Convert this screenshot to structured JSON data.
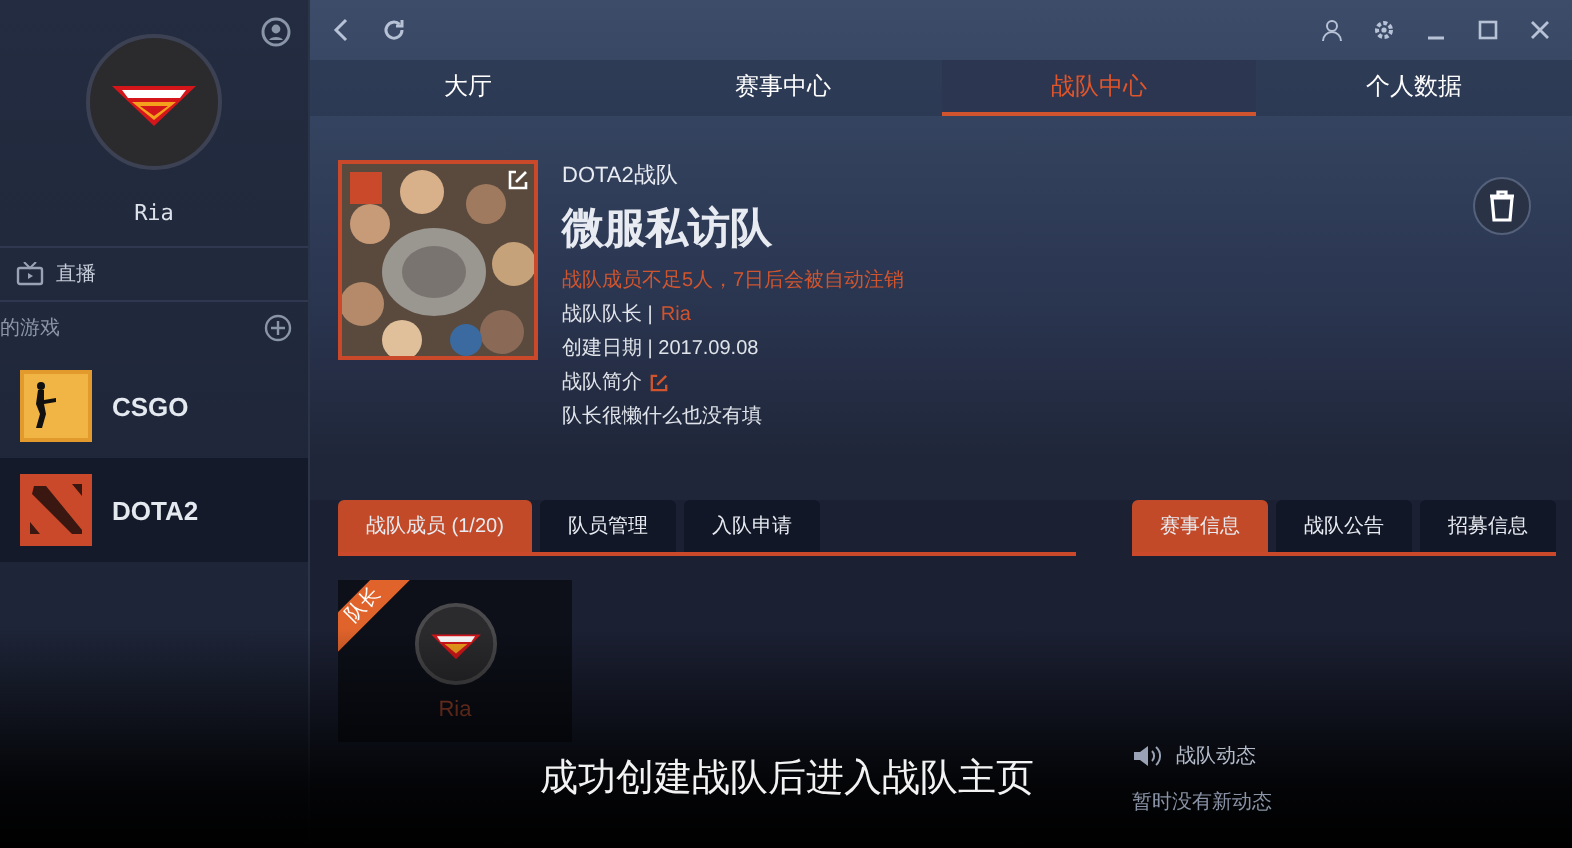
{
  "sidebar": {
    "username": "Ria",
    "live_label": "直播",
    "games_heading": "的游戏",
    "games": [
      {
        "name": "CSGO",
        "kind": "csgo",
        "selected": false
      },
      {
        "name": "DOTA2",
        "kind": "dota",
        "selected": true
      }
    ]
  },
  "nav_tabs": [
    {
      "label": "大厅",
      "selected": false
    },
    {
      "label": "赛事中心",
      "selected": false
    },
    {
      "label": "战队中心",
      "selected": true
    },
    {
      "label": "个人数据",
      "selected": false
    }
  ],
  "team": {
    "game_label": "DOTA2战队",
    "name": "微服私访队",
    "warning": "战队成员不足5人，7日后会被自动注销",
    "captain_label": "战队队长 |",
    "captain": "Ria",
    "created": "创建日期 | 2017.09.08",
    "intro_label": "战队简介",
    "intro": "队长很懒什么也没有填"
  },
  "member_tabs": [
    {
      "label": "战队成员 (1/20)",
      "selected": true
    },
    {
      "label": "队员管理",
      "selected": false
    },
    {
      "label": "入队申请",
      "selected": false
    }
  ],
  "members": [
    {
      "name": "Ria",
      "badge": "队长"
    }
  ],
  "info_tabs": [
    {
      "label": "赛事信息",
      "selected": true
    },
    {
      "label": "战队公告",
      "selected": false
    },
    {
      "label": "招募信息",
      "selected": false
    }
  ],
  "activity": {
    "title": "战队动态",
    "empty": "暂时没有新动态"
  },
  "caption": "成功创建战队后进入战队主页"
}
